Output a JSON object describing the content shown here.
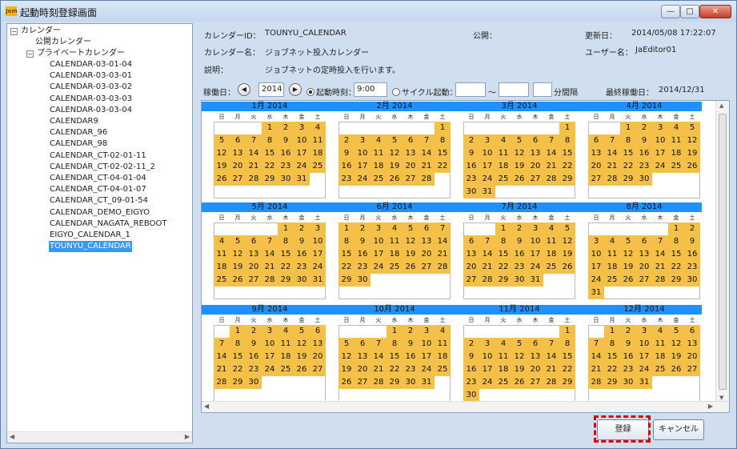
{
  "window": {
    "title": "起動時刻登録画面",
    "app_icon_text": "Jem"
  },
  "tree": {
    "root": "カレンダー",
    "public": "公開カレンダー",
    "private": "プライベートカレンダー",
    "items": [
      "CALENDAR-03-01-04",
      "CALENDAR-03-03-01",
      "CALENDAR-03-03-02",
      "CALENDAR-03-03-03",
      "CALENDAR-03-03-04",
      "CALENDAR9",
      "CALENDAR_96",
      "CALENDAR_98",
      "CALENDAR_CT-02-01-11",
      "CALENDAR_CT-02-02-11_2",
      "CALENDAR_CT-04-01-04",
      "CALENDAR_CT-04-01-07",
      "CALENDAR_CT_09-01-54",
      "CALENDAR_DEMO_EIGYO",
      "CALENDAR_NAGATA_REBOOT",
      "EIGYO_CALENDAR_1",
      "TOUNYU_CALENDAR"
    ],
    "selected_index": 16
  },
  "info": {
    "calendar_id_label": "カレンダーID：",
    "calendar_id": "TOUNYU_CALENDAR",
    "public_label": "公開：",
    "updated_label": "更新日：",
    "updated": "2014/05/08 17:22:07",
    "calendar_name_label": "カレンダー名：",
    "calendar_name": "ジョブネット投入カレンダー",
    "user_label": "ユーザー名：",
    "user": "JaEditor01",
    "desc_label": "説明：",
    "desc": "ジョブネットの定時投入を行います。"
  },
  "controls": {
    "operation_day_label": "稼働日：",
    "prev_glyph": "◀",
    "next_glyph": "▶",
    "year": "2014",
    "start_time_label": "起動時刻：",
    "start_time": "9:00",
    "cycle_label": "サイクル起動：",
    "tilde": "～",
    "interval_label": "分間隔",
    "last_day_label": "最終稼働日：",
    "last_day": "2014/12/31"
  },
  "weekdays": [
    "日",
    "月",
    "火",
    "水",
    "木",
    "金",
    "土"
  ],
  "months": [
    {
      "label": "1月  2014",
      "first_weekday": 3,
      "days": 31
    },
    {
      "label": "2月  2014",
      "first_weekday": 6,
      "days": 28
    },
    {
      "label": "3月  2014",
      "first_weekday": 6,
      "days": 31
    },
    {
      "label": "4月  2014",
      "first_weekday": 2,
      "days": 30
    },
    {
      "label": "5月  2014",
      "first_weekday": 4,
      "days": 31
    },
    {
      "label": "6月  2014",
      "first_weekday": 0,
      "days": 30
    },
    {
      "label": "7月  2014",
      "first_weekday": 2,
      "days": 31
    },
    {
      "label": "8月  2014",
      "first_weekday": 5,
      "days": 31
    },
    {
      "label": "9月  2014",
      "first_weekday": 1,
      "days": 30
    },
    {
      "label": "10月  2014",
      "first_weekday": 3,
      "days": 31
    },
    {
      "label": "11月  2014",
      "first_weekday": 6,
      "days": 30
    },
    {
      "label": "12月  2014",
      "first_weekday": 1,
      "days": 31
    }
  ],
  "colors": {
    "operating_day": "#f5c048",
    "month_band": "#1e90ff",
    "selection": "#3399ff"
  },
  "buttons": {
    "register": "登録",
    "cancel": "キャンセル"
  }
}
